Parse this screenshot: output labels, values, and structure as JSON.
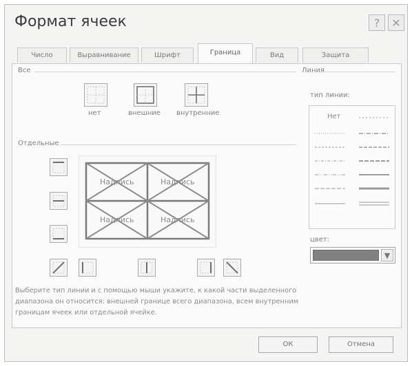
{
  "window": {
    "title": "Формат ячеек",
    "help_icon": "?",
    "close_icon": "✕"
  },
  "tabs": [
    {
      "label": "Число",
      "active": false
    },
    {
      "label": "Выравнивание",
      "active": false
    },
    {
      "label": "Шрифт",
      "active": false
    },
    {
      "label": "Граница",
      "active": true
    },
    {
      "label": "Вид",
      "active": false
    },
    {
      "label": "Защита",
      "active": false
    }
  ],
  "presets": {
    "section_label": "Все",
    "items": [
      {
        "label": "нет",
        "icon": "border-none-icon"
      },
      {
        "label": "внешние",
        "icon": "border-outline-icon"
      },
      {
        "label": "внутренние",
        "icon": "border-inside-icon"
      }
    ]
  },
  "individual": {
    "section_label": "Отдельные",
    "cell_text": [
      "Надпись",
      "Надпись",
      "Надпись",
      "Надпись"
    ]
  },
  "line": {
    "section_label": "Линия",
    "style_label": "тип линии:",
    "none_label": "Нет",
    "color_label": "цвет:",
    "color_value": "#808080"
  },
  "description": [
    "Выберите тип линии и с помощью мыши укажите, к какой части выделенного",
    "диапазона он относится: внешней границе всего диапазона, всем внутренним",
    "границам ячеек или отдельной ячейке."
  ],
  "buttons": {
    "ok": "ОК",
    "cancel": "Отмена"
  }
}
